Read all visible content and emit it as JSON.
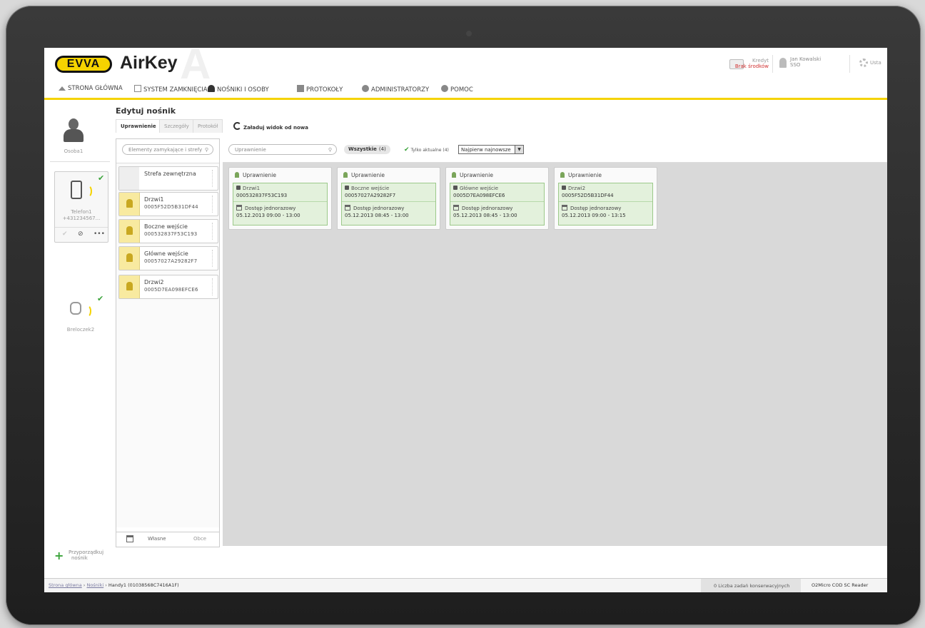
{
  "app": {
    "logo": "EVVA",
    "title": "AirKey",
    "credit_label": "Kredyt",
    "credit_status": "Brak środków",
    "user_name": "Jan Kowalski",
    "user_sub": "SSO",
    "settings_label": "Usta"
  },
  "nav": [
    {
      "label": "STRONA GŁÓWNA",
      "icon": "home-icon"
    },
    {
      "label": "SYSTEM ZAMKNIĘCIA",
      "icon": "lock-icon"
    },
    {
      "label": "NOŚNIKI I OSOBY",
      "icon": "people-icon"
    },
    {
      "label": "PROTOKOŁY",
      "icon": "document-icon"
    },
    {
      "label": "ADMINISTRATORZY",
      "icon": "admin-icon"
    },
    {
      "label": "POMOC",
      "icon": "help-icon"
    }
  ],
  "carriers": {
    "person_name": "Osoba1",
    "phone_name": "Telefon1",
    "phone_number": "+431234567...",
    "fob_name": "Breloczek2",
    "assign_label_1": "Przyporządkuj",
    "assign_label_2": "nośnik"
  },
  "editor": {
    "title": "Edytuj nośnik",
    "tabs": [
      "Uprawnienie",
      "Szczegóły",
      "Protokół"
    ],
    "reload_label": "Załaduj widok od nowa",
    "lock_search_placeholder": "Elementy zamykające i strefy",
    "locks": [
      {
        "name": "Strefa zewnętrzna",
        "code": ""
      },
      {
        "name": "Drzwi1",
        "code": "0005F52D5B31DF44"
      },
      {
        "name": "Boczne wejście",
        "code": "000532837F53C193"
      },
      {
        "name": "Główne wejście",
        "code": "00057027A29282F7"
      },
      {
        "name": "Drzwi2",
        "code": "0005D7EA098EFCE6"
      }
    ],
    "bottom_tabs": [
      "Własne",
      "Obce"
    ]
  },
  "filter": {
    "search_placeholder": "Uprawnienie",
    "all_label": "Wszystkie",
    "all_count": "(4)",
    "current_label": "Tylko aktualne (4)",
    "sort_value": "Najpierw najnowsze"
  },
  "authorizations": [
    {
      "header": "Uprawnienie",
      "lock": "Drzwi1",
      "code": "000532837F53C193",
      "type": "Dostęp jednorazowy",
      "time": "05.12.2013 09:00 - 13:00"
    },
    {
      "header": "Uprawnienie",
      "lock": "Boczne wejście",
      "code": "00057027A29282F7",
      "type": "Dostęp jednorazowy",
      "time": "05.12.2013 08:45 - 13:00"
    },
    {
      "header": "Uprawnienie",
      "lock": "Główne wejście",
      "code": "0005D7EA098EFCE6",
      "type": "Dostęp jednorazowy",
      "time": "05.12.2013 08:45 - 13:00"
    },
    {
      "header": "Uprawnienie",
      "lock": "Drzwi2",
      "code": "0005F52D5B31DF44",
      "type": "Dostęp jednorazowy",
      "time": "05.12.2013 09:00 - 13:15"
    }
  ],
  "statusbar": {
    "crumb_home": "Strona główna",
    "crumb_carriers": "Nośniki",
    "crumb_current": "Handy1 (01038568C7416A1F)",
    "tasks": "0  Liczba zadań konserwacyjnych",
    "reader": "O2Micro COD SC Reader"
  },
  "colors": {
    "accent": "#f5d300",
    "success": "#3aa33a",
    "auth_bg": "#e3f1dc"
  }
}
